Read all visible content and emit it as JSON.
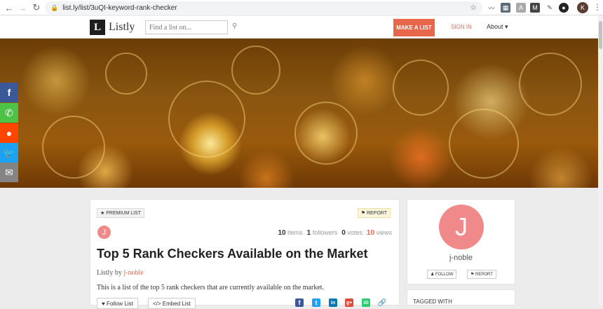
{
  "browser": {
    "url": "list.ly/list/3uQI-keyword-rank-checker",
    "profile_initial": "K"
  },
  "nav": {
    "logo_letter": "L",
    "logo_text": "Listly",
    "search_placeholder": "Find a list on...",
    "make_list": "MAKE A LIST",
    "sign_in": "SIGN IN",
    "about": "About ▾"
  },
  "share_bar": {
    "items": [
      {
        "name": "facebook",
        "glyph": "f",
        "color": "#3b5998"
      },
      {
        "name": "whatsapp",
        "glyph": "✆",
        "color": "#4dc247"
      },
      {
        "name": "reddit",
        "glyph": "●",
        "color": "#ff4500"
      },
      {
        "name": "twitter",
        "glyph": "🐦",
        "color": "#1da1f2"
      },
      {
        "name": "email",
        "glyph": "✉",
        "color": "#848484"
      }
    ]
  },
  "list": {
    "premium_label": "★ PREMIUM LIST",
    "report_label": "⚑ REPORT",
    "avatar_initial": "J",
    "items_count": "10",
    "items_label": "items",
    "followers_count": "1",
    "followers_label": "followers",
    "votes_count": "0",
    "votes_label": "votes",
    "views_count": "10",
    "views_label": "views",
    "title": "Top 5 Rank Checkers Available on the Market",
    "by_prefix": "Listly by",
    "author": "j-noble",
    "description": "This is a list of the top 5 rank checkers that are currently available on the market.",
    "follow_label": "♥ Follow List",
    "embed_label": "</> Embed List"
  },
  "share_icons": [
    {
      "name": "facebook",
      "glyph": "f",
      "color": "#3b5998"
    },
    {
      "name": "twitter",
      "glyph": "t",
      "color": "#1da1f2"
    },
    {
      "name": "linkedin",
      "glyph": "in",
      "color": "#0077b5"
    },
    {
      "name": "google-plus",
      "glyph": "g+",
      "color": "#dd4b39"
    },
    {
      "name": "email",
      "glyph": "✉",
      "color": "#2ecc71"
    },
    {
      "name": "link",
      "glyph": "🔗",
      "color": "#3b5998"
    }
  ],
  "profile": {
    "initial": "J",
    "name": "j-noble",
    "follow": "♟ FOLLOW",
    "report": "⚑ REPORT"
  },
  "tags": {
    "title": "TAGGED WITH"
  }
}
